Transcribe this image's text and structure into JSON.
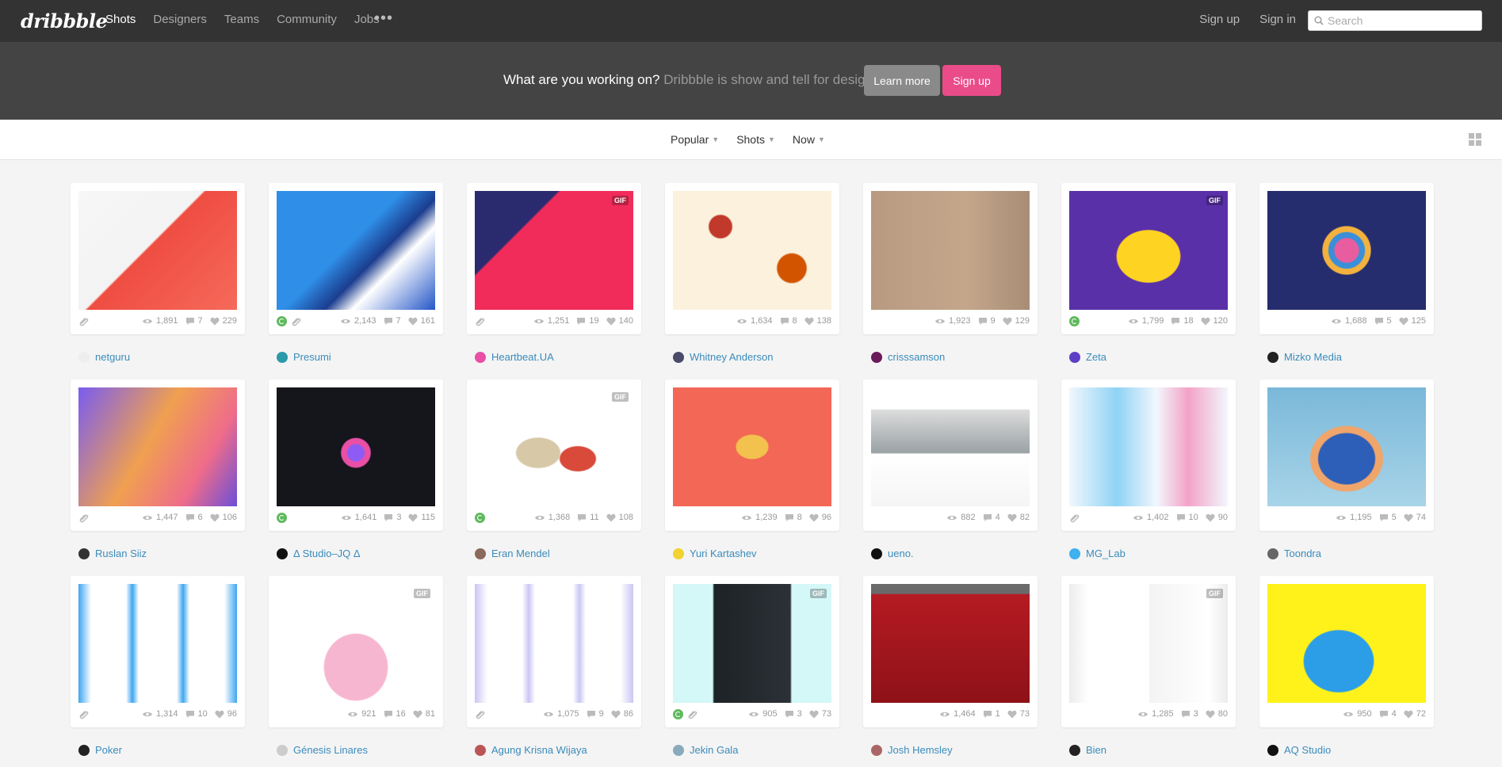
{
  "nav": {
    "logo": "dribbble",
    "links": [
      "Shots",
      "Designers",
      "Teams",
      "Community",
      "Jobs"
    ],
    "more": "•••",
    "signup": "Sign up",
    "signin": "Sign in",
    "search_placeholder": "Search"
  },
  "banner": {
    "question": "What are you working on?",
    "subtitle": "Dribbble is show and tell for designers.",
    "learn_more": "Learn more",
    "sign_up": "Sign up"
  },
  "filters": [
    "Popular",
    "Shots",
    "Now"
  ],
  "colors": {
    "brand_pink": "#ea4c89",
    "link_blue": "#3a8bbb",
    "nav_bg": "#333333",
    "banner_bg": "#444444"
  },
  "shots": [
    {
      "author": "netguru",
      "views": "1,891",
      "comments": "7",
      "likes": "229",
      "rebound": false,
      "attachment": true,
      "gif": false
    },
    {
      "author": "Presumi",
      "views": "2,143",
      "comments": "7",
      "likes": "161",
      "rebound": true,
      "attachment": true,
      "gif": false
    },
    {
      "author": "Heartbeat.UA",
      "views": "1,251",
      "comments": "19",
      "likes": "140",
      "rebound": false,
      "attachment": true,
      "gif": true
    },
    {
      "author": "Whitney Anderson",
      "views": "1,634",
      "comments": "8",
      "likes": "138",
      "rebound": false,
      "attachment": false,
      "gif": false
    },
    {
      "author": "crisssamson",
      "views": "1,923",
      "comments": "9",
      "likes": "129",
      "rebound": false,
      "attachment": false,
      "gif": false
    },
    {
      "author": "Zeta",
      "views": "1,799",
      "comments": "18",
      "likes": "120",
      "rebound": true,
      "attachment": false,
      "gif": true
    },
    {
      "author": "Mizko Media",
      "views": "1,688",
      "comments": "5",
      "likes": "125",
      "rebound": false,
      "attachment": false,
      "gif": false
    },
    {
      "author": "Ruslan Siiz",
      "views": "1,447",
      "comments": "6",
      "likes": "106",
      "rebound": false,
      "attachment": true,
      "gif": false
    },
    {
      "author": "Δ Studio–JQ Δ",
      "views": "1,641",
      "comments": "3",
      "likes": "115",
      "rebound": true,
      "attachment": false,
      "gif": false
    },
    {
      "author": "Eran Mendel",
      "views": "1,368",
      "comments": "11",
      "likes": "108",
      "rebound": true,
      "attachment": false,
      "gif": true
    },
    {
      "author": "Yuri Kartashev",
      "views": "1,239",
      "comments": "8",
      "likes": "96",
      "rebound": false,
      "attachment": false,
      "gif": false
    },
    {
      "author": "ueno.",
      "views": "882",
      "comments": "4",
      "likes": "82",
      "rebound": false,
      "attachment": false,
      "gif": false
    },
    {
      "author": "MG_Lab",
      "views": "1,402",
      "comments": "10",
      "likes": "90",
      "rebound": false,
      "attachment": true,
      "gif": false
    },
    {
      "author": "Toondra",
      "views": "1,195",
      "comments": "5",
      "likes": "74",
      "rebound": false,
      "attachment": false,
      "gif": false
    },
    {
      "author": "Poker",
      "views": "1,314",
      "comments": "10",
      "likes": "96",
      "rebound": false,
      "attachment": true,
      "gif": false
    },
    {
      "author": "Génesis Linares",
      "views": "921",
      "comments": "16",
      "likes": "81",
      "rebound": false,
      "attachment": false,
      "gif": true
    },
    {
      "author": "Agung Krisna Wijaya",
      "views": "1,075",
      "comments": "9",
      "likes": "86",
      "rebound": false,
      "attachment": true,
      "gif": false
    },
    {
      "author": "Jekin Gala",
      "views": "905",
      "comments": "3",
      "likes": "73",
      "rebound": true,
      "attachment": true,
      "gif": true
    },
    {
      "author": "Josh Hemsley",
      "views": "1,464",
      "comments": "1",
      "likes": "73",
      "rebound": false,
      "attachment": false,
      "gif": false
    },
    {
      "author": "Bien",
      "views": "1,285",
      "comments": "3",
      "likes": "80",
      "rebound": false,
      "attachment": false,
      "gif": true
    },
    {
      "author": "AQ Studio",
      "views": "950",
      "comments": "4",
      "likes": "72",
      "rebound": false,
      "attachment": false,
      "gif": false
    }
  ]
}
